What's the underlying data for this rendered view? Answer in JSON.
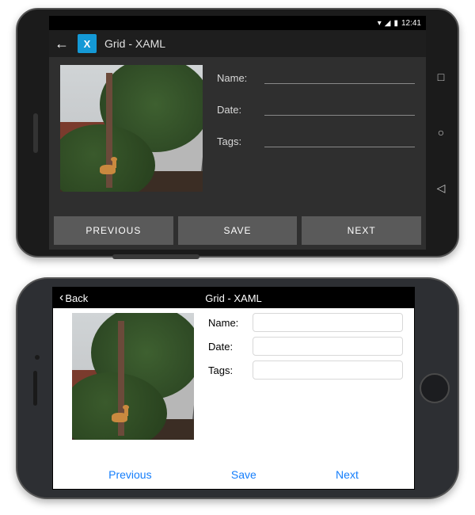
{
  "android": {
    "status": {
      "time": "12:41"
    },
    "title": "Grid - XAML",
    "form": {
      "name_label": "Name:",
      "date_label": "Date:",
      "tags_label": "Tags:",
      "name_value": "",
      "date_value": "",
      "tags_value": ""
    },
    "buttons": {
      "previous": "PREVIOUS",
      "save": "SAVE",
      "next": "NEXT"
    }
  },
  "ios": {
    "nav": {
      "back_label": "Back",
      "title": "Grid - XAML"
    },
    "form": {
      "name_label": "Name:",
      "date_label": "Date:",
      "tags_label": "Tags:",
      "name_value": "",
      "date_value": "",
      "tags_value": ""
    },
    "buttons": {
      "previous": "Previous",
      "save": "Save",
      "next": "Next"
    }
  }
}
